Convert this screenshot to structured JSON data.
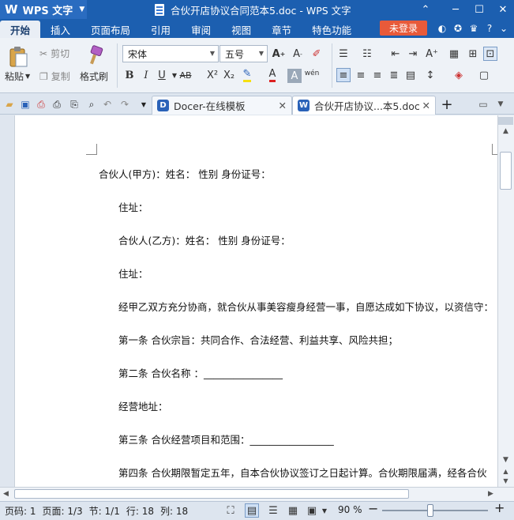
{
  "app": {
    "name": "WPS 文字",
    "logo": "W"
  },
  "window": {
    "title": "合伙开店协议合同范本5.doc - WPS 文字"
  },
  "menu": {
    "items": [
      "开始",
      "插入",
      "页面布局",
      "引用",
      "审阅",
      "视图",
      "章节",
      "特色功能"
    ],
    "login": "未登录"
  },
  "ribbon": {
    "paste": "粘贴",
    "cut": "剪切",
    "copy": "复制",
    "format_painter": "格式刷",
    "font_name": "宋体",
    "font_size": "五号"
  },
  "tabs": [
    {
      "label": "Docer-在线模板",
      "icon": "docer-icon"
    },
    {
      "label": "合伙开店协议...本5.doc",
      "icon": "word-doc-icon"
    }
  ],
  "document": {
    "paragraphs": [
      "合伙人(甲方)：姓名：  性别  身份证号：",
      "住址：",
      "合伙人(乙方)：姓名：  性别  身份证号：",
      "住址：",
      "经甲乙双方充分协商，就合伙从事美容瘦身经营一事，自愿达成如下协议，以资信守：",
      "第一条  合伙宗旨：共同合作、合法经营、利益共享、风险共担；",
      "第二条  合伙名称  ：________________",
      "经营地址：",
      "第三条  合伙经营项目和范围：_________________",
      "第四条  合伙期限暂定五年，自本合伙协议签订之日起计算。合伙期限届满，经各合伙"
    ]
  },
  "status": {
    "page_num": "页码: 1",
    "pages": "页面: 1/3",
    "section": "节: 1/1",
    "row": "行: 18",
    "col": "列: 18",
    "zoom": "90 %"
  },
  "colors": {
    "titlebar": "#1c5fb0",
    "accent_login": "#e85a3a",
    "page": "#ffffff"
  }
}
